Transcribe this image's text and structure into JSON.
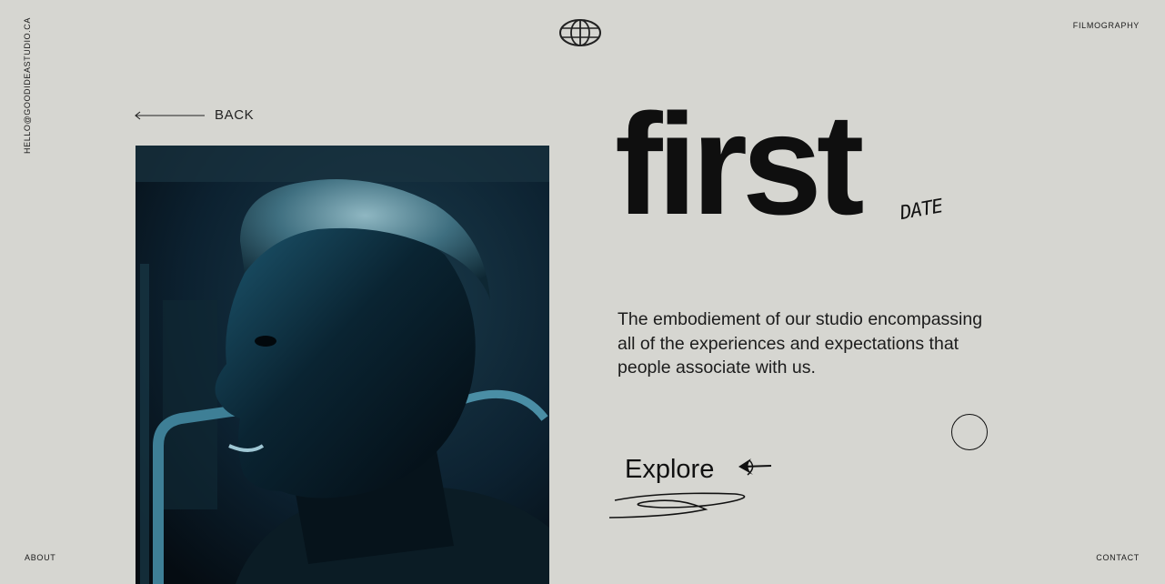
{
  "header": {
    "email": "HELLO@GOODIDEASTUDIO.CA",
    "logo_icon": "globe-icon",
    "filmography_label": "FILMOGRAPHY"
  },
  "footer": {
    "about_label": "ABOUT",
    "contact_label": "CONTACT"
  },
  "back": {
    "label": "BACK",
    "icon": "arrow-left-icon"
  },
  "hero": {
    "title": "first",
    "title_tag": "DATE",
    "description": "The embodiement of our studio encompassing all of the experiences and expectations that people associate with us.",
    "explore_label": "Explore",
    "explore_icon": "scribble-arrow-icon"
  },
  "colors": {
    "background": "#d6d6d1",
    "text": "#111111",
    "photo_tint": "#0e3345"
  }
}
